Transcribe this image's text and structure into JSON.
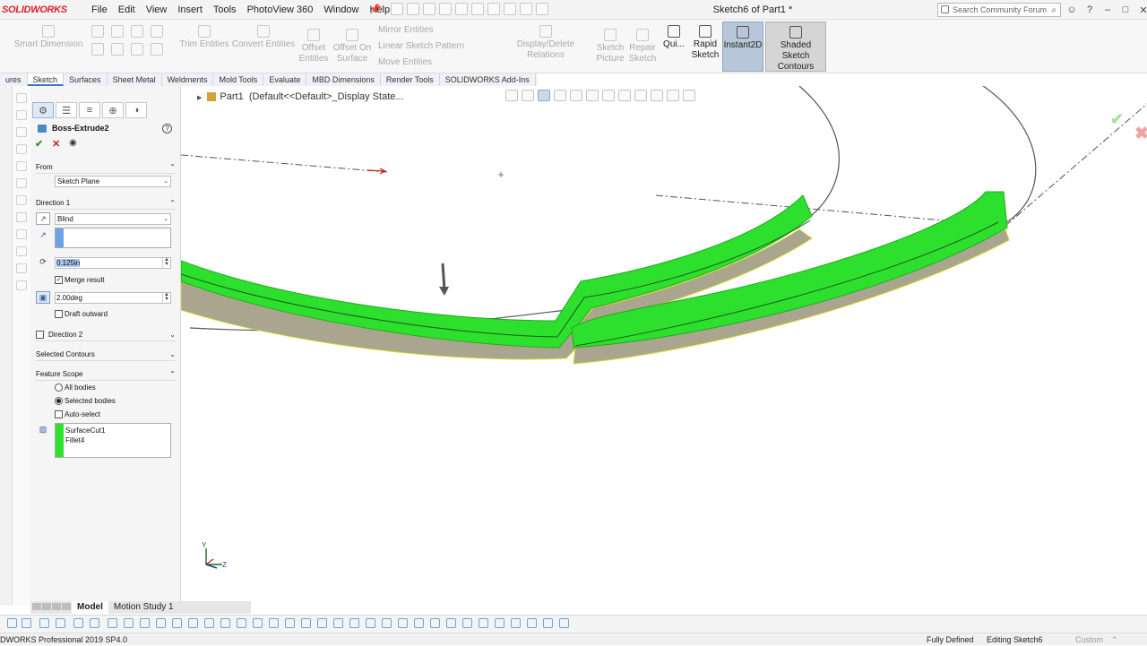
{
  "app": {
    "logo": "SOLIDWORKS",
    "window_title": "Sketch6 of Part1 *",
    "menu": [
      "File",
      "Edit",
      "View",
      "Insert",
      "Tools",
      "PhotoView 360",
      "Window",
      "Help"
    ],
    "search_placeholder": "Search Community Forum"
  },
  "ribbon": {
    "smart_dimension": "Smart Dimension",
    "trim_entities": "Trim Entities",
    "convert_entities": "Convert Entities",
    "offset_entities_1": "Offset",
    "offset_entities_2": "Entities",
    "offset_on_surface_1": "Offset On",
    "offset_on_surface_2": "Surface",
    "mirror_entities": "Mirror Entities",
    "linear_sketch_pattern": "Linear Sketch Pattern",
    "move_entities": "Move Entities",
    "display_delete_relations": "Display/Delete Relations",
    "sketch_picture_1": "Sketch",
    "sketch_picture_2": "Picture",
    "repair_sketch_1": "Repair",
    "repair_sketch_2": "Sketch",
    "quick_snaps": "Qui...",
    "rapid_sketch_1": "Rapid",
    "rapid_sketch_2": "Sketch",
    "instant2d": "Instant2D",
    "shaded_contours_1": "Shaded Sketch",
    "shaded_contours_2": "Contours"
  },
  "tabs": [
    "ures",
    "Sketch",
    "Surfaces",
    "Sheet Metal",
    "Weldments",
    "Mold Tools",
    "Evaluate",
    "MBD Dimensions",
    "Render Tools",
    "SOLIDWORKS Add-Ins"
  ],
  "property_manager": {
    "feature_name": "Boss-Extrude2",
    "help": "?",
    "from_label": "From",
    "from_value": "Sketch Plane",
    "direction1_label": "Direction 1",
    "end_condition": "Blind",
    "depth": "0.125in",
    "merge_result": "Merge result",
    "draft_angle": "2.00deg",
    "draft_outward": "Draft outward",
    "direction2_label": "Direction 2",
    "selected_contours_label": "Selected Contours",
    "feature_scope_label": "Feature Scope",
    "all_bodies": "All bodies",
    "selected_bodies": "Selected bodies",
    "auto_select": "Auto-select",
    "bodies": [
      "SurfaceCut1",
      "Fillet4"
    ]
  },
  "viewport": {
    "tree_root": "Part1",
    "tree_config": "(Default<<Default>_Display State...",
    "axis_y": "Y",
    "axis_z": "Z"
  },
  "bottom_tabs": {
    "model": "Model",
    "motion": "Motion Study 1"
  },
  "status": {
    "version": "DWORKS Professional 2019 SP4.0",
    "defined": "Fully Defined",
    "editing": "Editing Sketch6",
    "units": "Custom"
  },
  "colors": {
    "extrude_green": "#2ee02e",
    "logo_red": "#d9222a",
    "highlight_blue": "#6ba3e8"
  }
}
